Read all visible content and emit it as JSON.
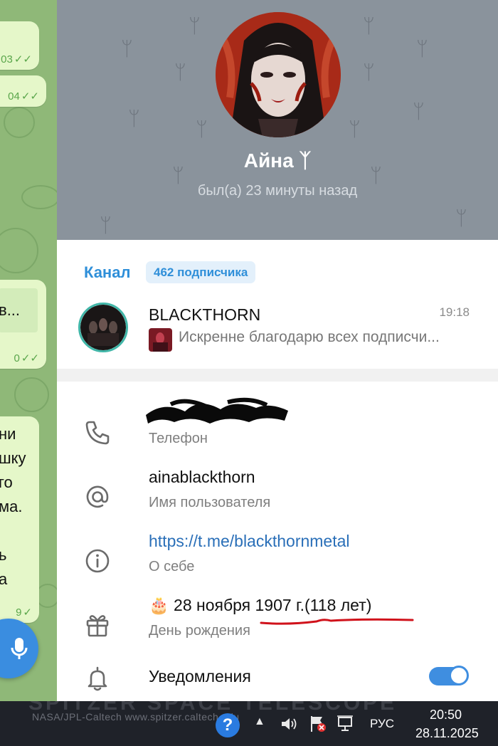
{
  "chat": {
    "bubbles": [
      {
        "time": "03",
        "ticks": "✓✓"
      },
      {
        "time": "04",
        "ticks": "✓✓"
      },
      {
        "text": "в...",
        "time": "0",
        "ticks": "✓✓"
      },
      {
        "text": "ни\nшку\nго\nма.\n\nь\nа",
        "time": "9",
        "ticks": "✓"
      }
    ]
  },
  "profile": {
    "name": "Айна ᛉ",
    "status": "был(а) 23 минуты назад"
  },
  "channel": {
    "heading": "Канал",
    "subscribers": "462 подписчика",
    "name": "BLACKTHORN",
    "time": "19:18",
    "preview": "Искренне благодарю всех подписчи..."
  },
  "info": {
    "phone_label": "Телефон",
    "username": "ainablackthorn",
    "username_label": "Имя пользователя",
    "bio": "https://t.me/blackthornmetal",
    "bio_label": "О себе",
    "birthday": "🎂 28 ноября 1907 г.(118 лет)",
    "birthday_label": "День рождения",
    "notifications": "Уведомления",
    "notifications_enabled": true
  },
  "taskbar": {
    "wallpaper_credit": "NASA/JPL-Caltech   www.spitzer.caltech.edu",
    "wallpaper_title": "SPITZER SPACE TELESCOPE",
    "language": "РУС",
    "time": "20:50",
    "date": "28.11.2025"
  },
  "colors": {
    "accent": "#3f8ee0",
    "header_bg": "#8a939c",
    "chat_bg": "#8fb878",
    "bubble": "#e5f7c9",
    "underline": "#d0121b"
  }
}
